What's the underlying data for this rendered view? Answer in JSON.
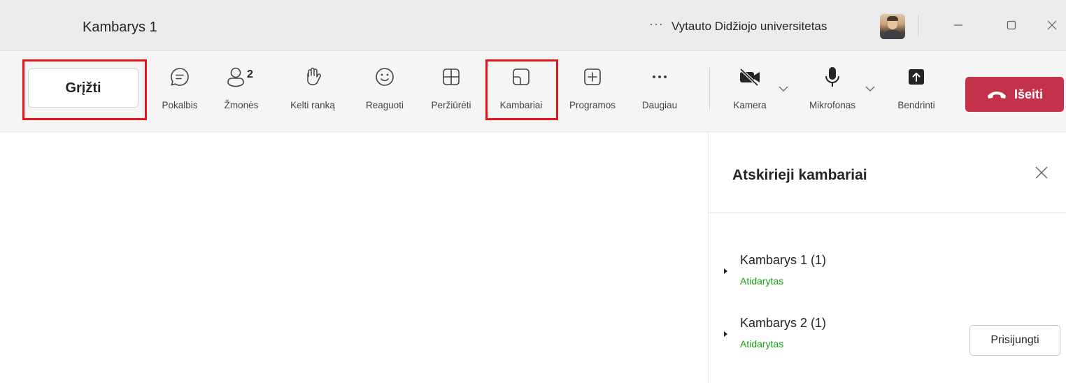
{
  "titlebar": {
    "title": "Kambarys 1",
    "more_label": "···",
    "organization": "Vytauto Didžiojo universitetas"
  },
  "toolbar": {
    "back_label": "Grįžti",
    "tools": {
      "chat": "Pokalbis",
      "people": "Žmonės",
      "people_count": "2",
      "raise_hand": "Kelti ranką",
      "react": "Reaguoti",
      "view": "Peržiūrėti",
      "rooms": "Kambariai",
      "apps": "Programos",
      "more": "Daugiau",
      "camera": "Kamera",
      "mic": "Mikrofonas",
      "share": "Bendrinti"
    },
    "leave_label": "Išeiti",
    "leave_color": "#c4314b"
  },
  "panel": {
    "title": "Atskirieji kambariai",
    "rooms": [
      {
        "name": "Kambarys 1  (1)",
        "status": "Atidarytas"
      },
      {
        "name": "Kambarys 2  (1)",
        "status": "Atidarytas",
        "join_label": "Prisijungti"
      }
    ],
    "status_color": "#13a10e"
  },
  "highlight_color": "#e8141c"
}
